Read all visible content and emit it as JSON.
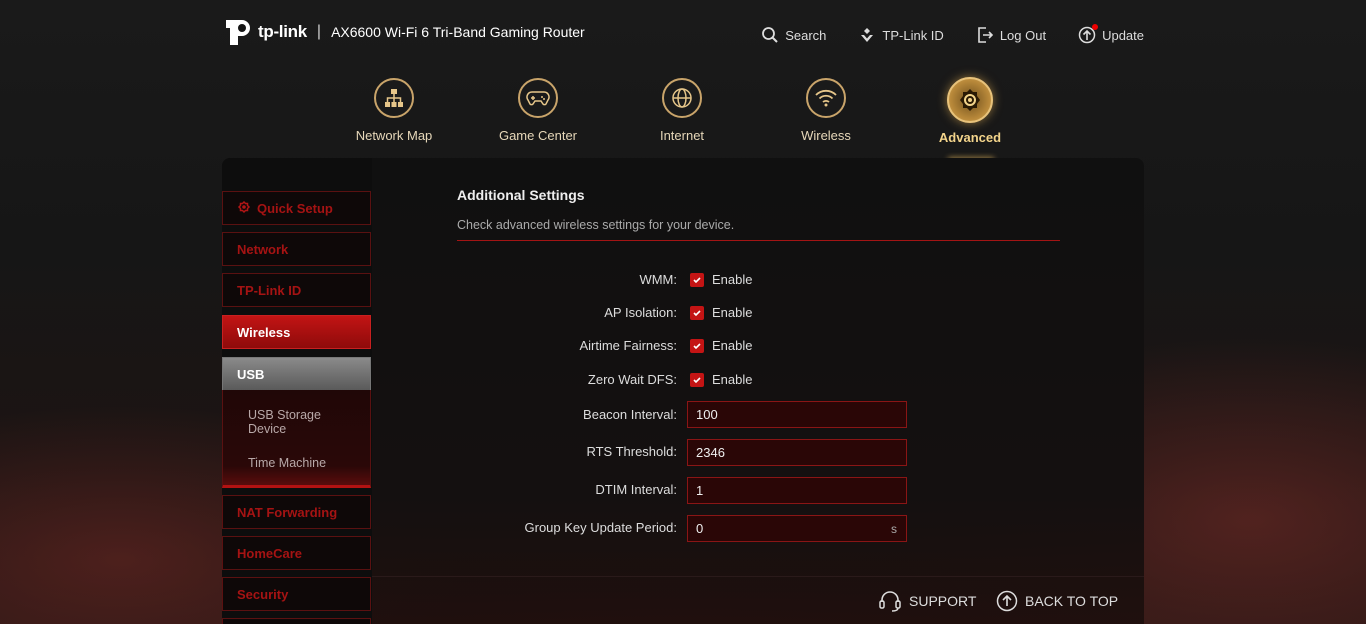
{
  "header": {
    "brand": "tp-link",
    "model": "AX6600 Wi-Fi 6 Tri-Band Gaming Router",
    "nav": {
      "search": "Search",
      "tplink_id": "TP-Link ID",
      "logout": "Log Out",
      "update": "Update"
    }
  },
  "tabs": [
    {
      "label": "Network Map",
      "icon": "network-map-icon"
    },
    {
      "label": "Game Center",
      "icon": "gamepad-icon"
    },
    {
      "label": "Internet",
      "icon": "globe-icon"
    },
    {
      "label": "Wireless",
      "icon": "wifi-icon"
    },
    {
      "label": "Advanced",
      "icon": "gear-icon",
      "active": true
    }
  ],
  "sidebar": {
    "items": [
      {
        "label": "Quick Setup"
      },
      {
        "label": "Network"
      },
      {
        "label": "TP-Link ID"
      },
      {
        "label": "Wireless",
        "active": true
      },
      {
        "label": "USB",
        "expanded": true
      },
      {
        "label": "NAT Forwarding"
      },
      {
        "label": "HomeCare"
      },
      {
        "label": "Security"
      }
    ],
    "usb_sub": [
      {
        "label": "USB Storage Device"
      },
      {
        "label": "Time Machine"
      }
    ]
  },
  "content": {
    "title": "Additional Settings",
    "description": "Check advanced wireless settings for your device.",
    "checkboxes": [
      {
        "label": "WMM:",
        "option": "Enable",
        "checked": true
      },
      {
        "label": "AP Isolation:",
        "option": "Enable",
        "checked": true
      },
      {
        "label": "Airtime Fairness:",
        "option": "Enable",
        "checked": true
      },
      {
        "label": "Zero Wait DFS:",
        "option": "Enable",
        "checked": true
      }
    ],
    "fields": [
      {
        "label": "Beacon Interval:",
        "value": "100"
      },
      {
        "label": "RTS Threshold:",
        "value": "2346"
      },
      {
        "label": "DTIM Interval:",
        "value": "1"
      },
      {
        "label": "Group Key Update Period:",
        "value": "0",
        "unit": "s"
      }
    ]
  },
  "footer": {
    "support": "SUPPORT",
    "back_to_top": "BACK TO TOP"
  },
  "colors": {
    "accent_red": "#c41414",
    "gold": "#c9a46a"
  }
}
